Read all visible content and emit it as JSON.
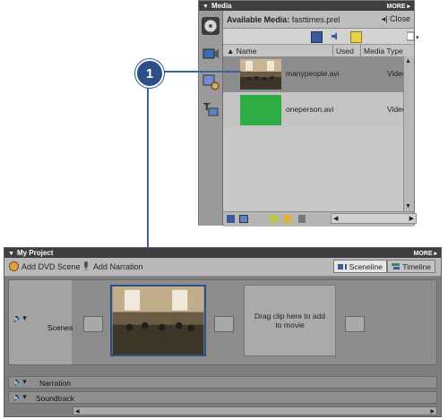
{
  "media_panel": {
    "title": "Media",
    "more": "MORE",
    "header_label": "Available Media:",
    "header_file": "fasttimes.prel",
    "close_label": "Close",
    "columns": [
      "Name",
      "Used",
      "Media Type"
    ],
    "rows": [
      {
        "name": "manypeople.avi",
        "type": "Video"
      },
      {
        "name": "oneperson.avi",
        "type": "Video"
      }
    ],
    "sidebar_icons": [
      "dvd-icon",
      "film-capture-icon",
      "effects-icon",
      "titles-icon"
    ]
  },
  "callout": {
    "number": "1"
  },
  "project_panel": {
    "title": "My Project",
    "more": "MORE",
    "add_dvd_scene": "Add DVD Scene",
    "add_narration": "Add Narration",
    "sceneline_label": "Sceneline",
    "timeline_label": "Timeline",
    "scenes_label": "Scenes",
    "drag_text": "Drag clip here to add to movie",
    "narration_label": "Narration",
    "soundtrack_label": "Soundtrack"
  },
  "colors": {
    "accent": "#2c4f86",
    "green_clip": "#2fad45"
  }
}
